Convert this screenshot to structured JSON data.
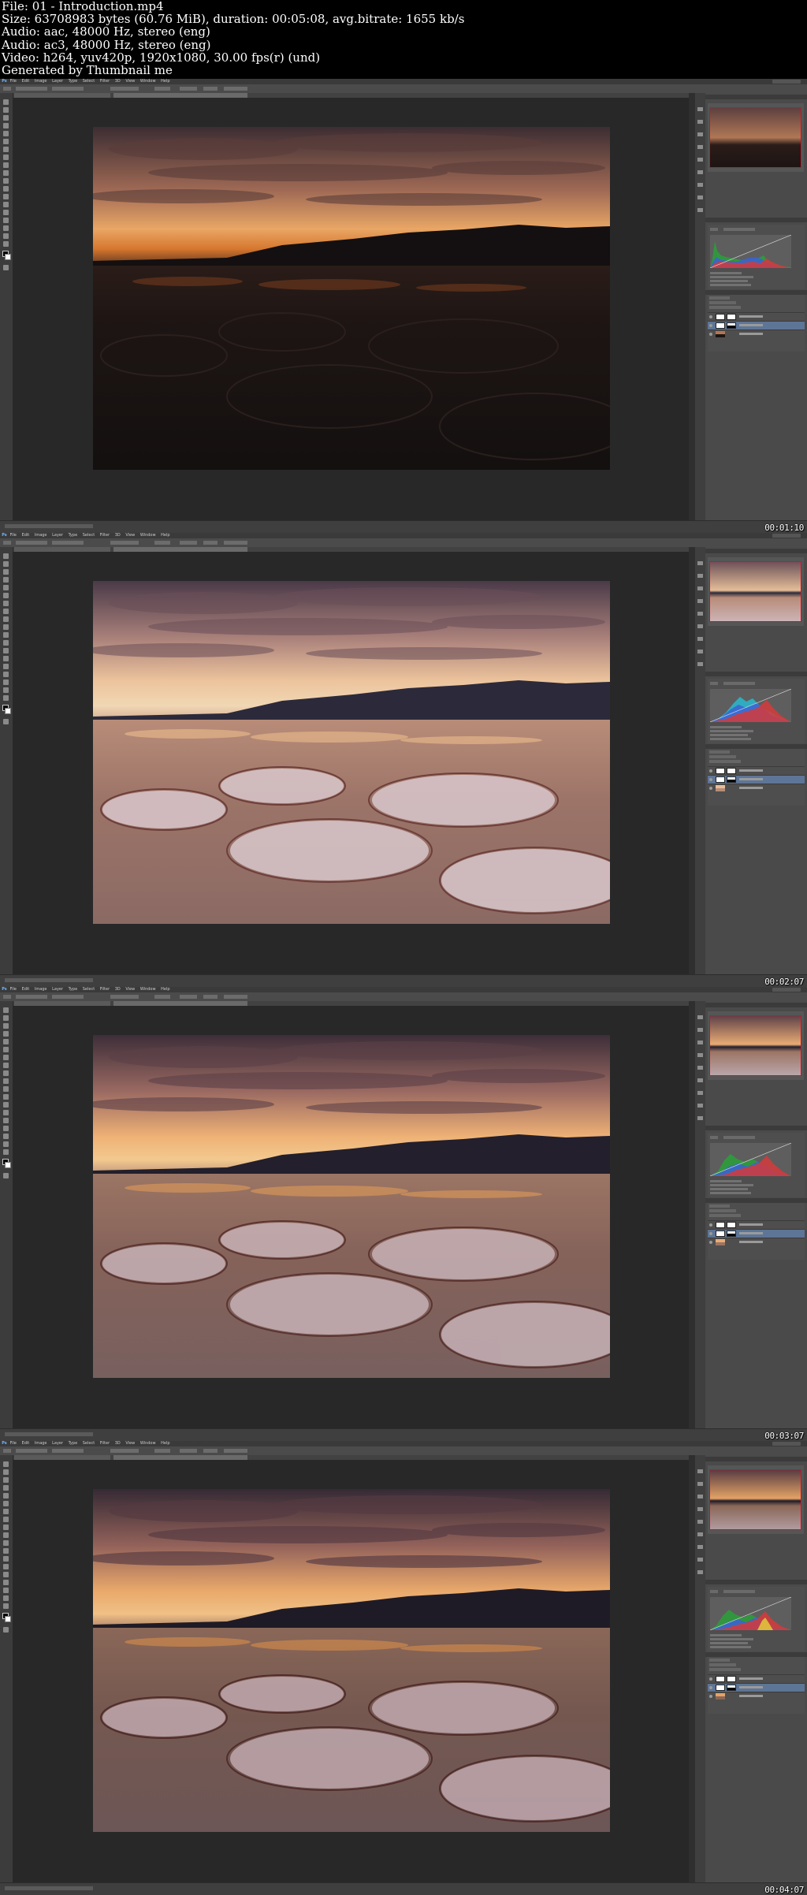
{
  "header": {
    "file_line": "File: 01 - Introduction.mp4",
    "size_line": "Size: 63708983 bytes (60.76 MiB), duration: 00:05:08, avg.bitrate: 1655 kb/s",
    "audio1_line": "Audio: aac, 48000 Hz, stereo (eng)",
    "audio2_line": "Audio: ac3, 48000 Hz, stereo (eng)",
    "video_line": "Video: h264, yuv420p, 1920x1080, 30.00 fps(r) (und)",
    "generator_line": "Generated by Thumbnail me"
  },
  "frames": [
    {
      "timestamp": "00:01:10",
      "image_state": "dark-underexposed"
    },
    {
      "timestamp": "00:02:07",
      "image_state": "bright-adjusted"
    },
    {
      "timestamp": "00:03:07",
      "image_state": "balanced"
    },
    {
      "timestamp": "00:04:07",
      "image_state": "final-contrast"
    }
  ],
  "app": {
    "logo": "Ps",
    "menu": [
      "File",
      "Edit",
      "Image",
      "Layer",
      "Type",
      "Select",
      "Filter",
      "3D",
      "View",
      "Window",
      "Help"
    ]
  },
  "colors": {
    "ui_dark": "#535353",
    "canvas_bg": "#282828",
    "navigator_view_box": "#d0112b",
    "selected_layer": "#5d7596"
  }
}
